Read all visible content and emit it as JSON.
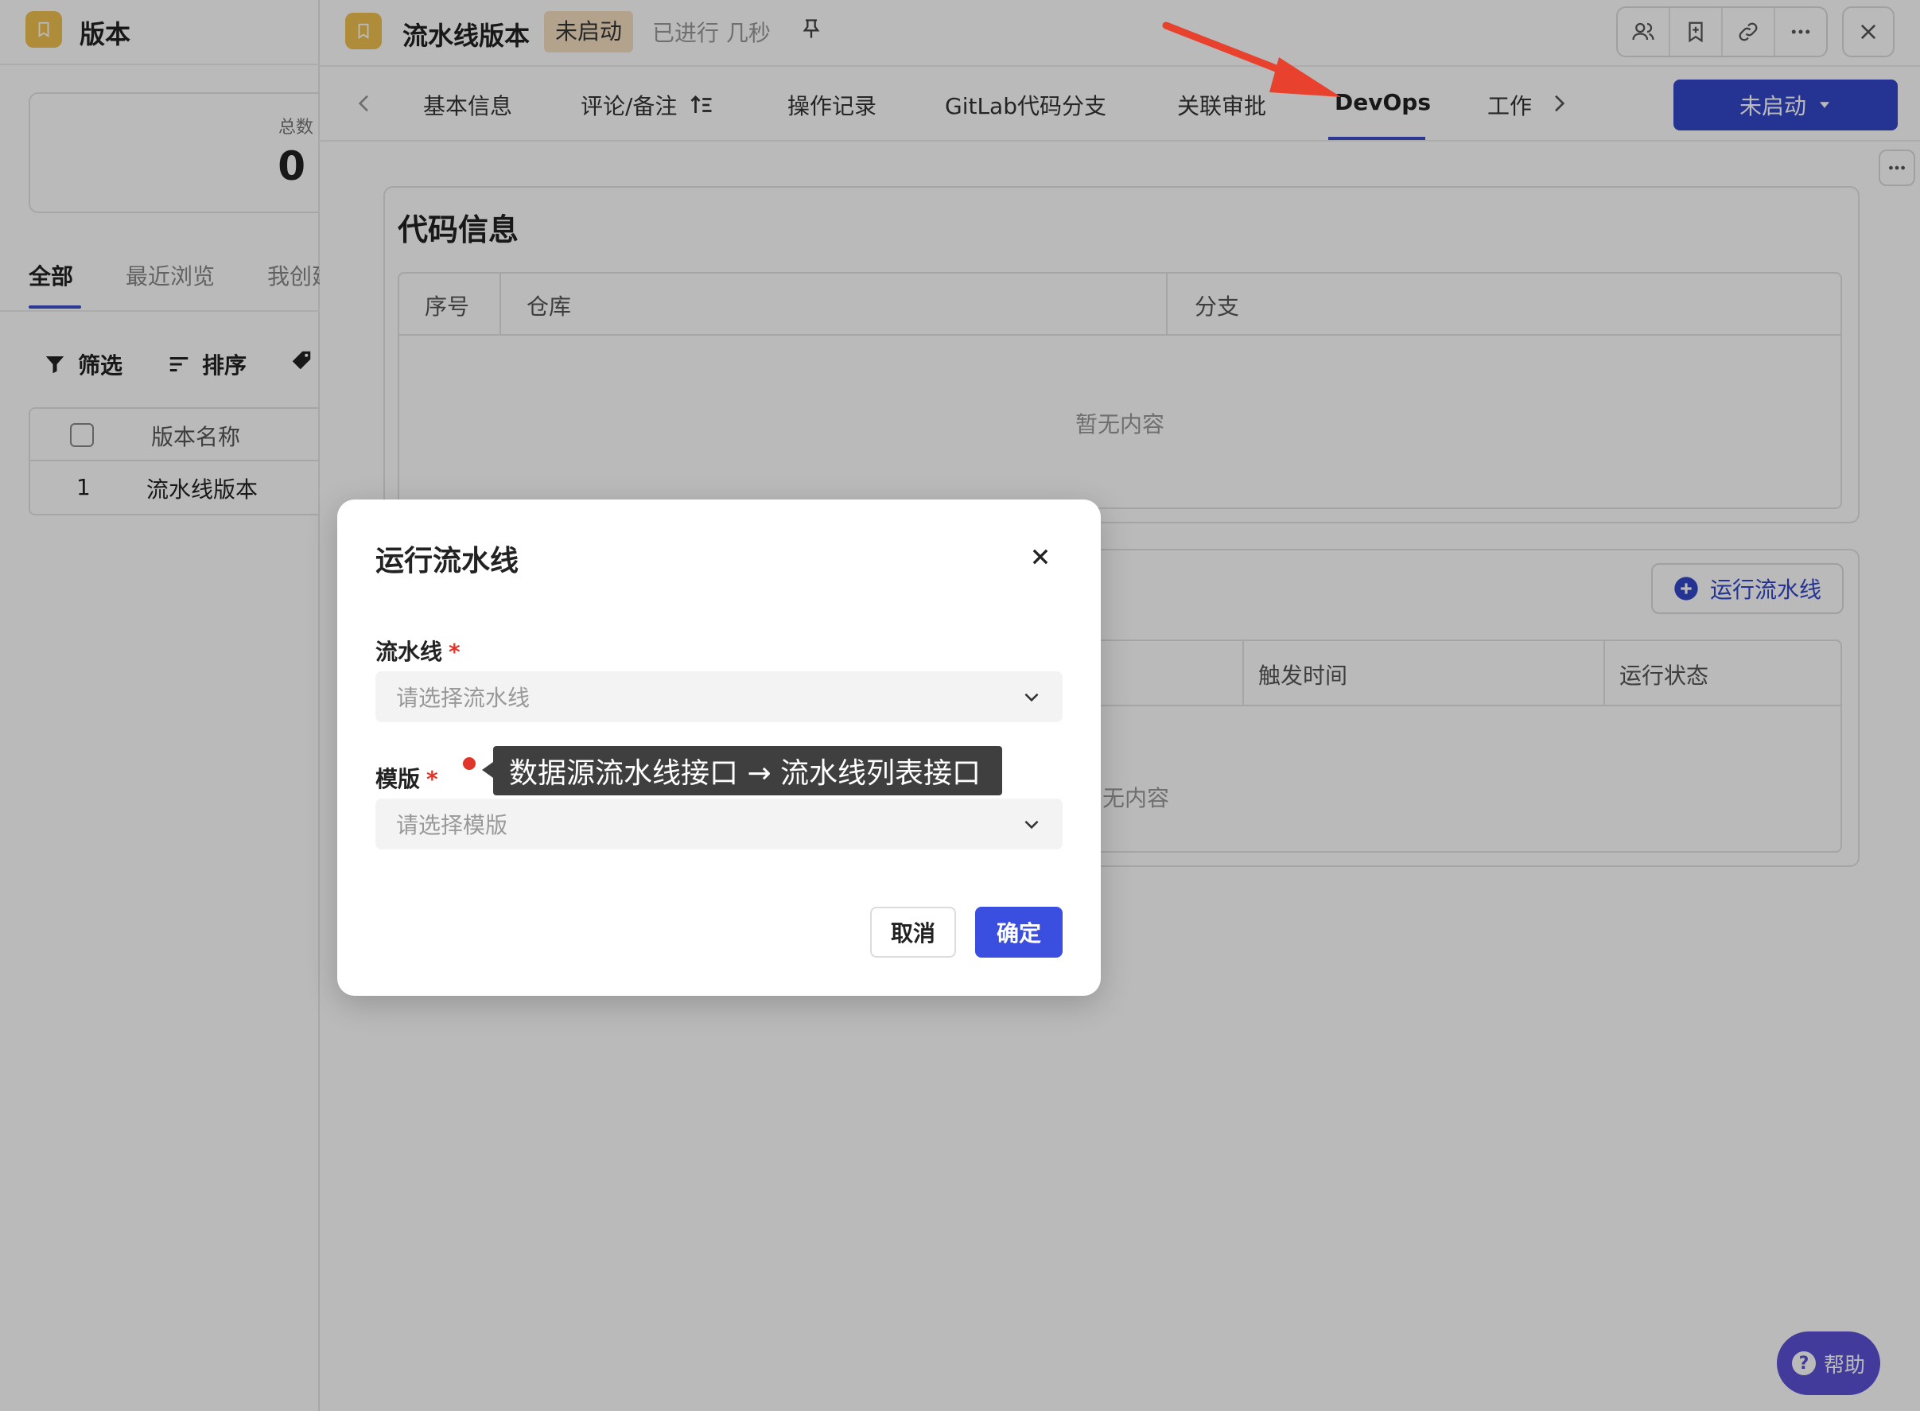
{
  "left_panel": {
    "title": "版本",
    "stat": {
      "label": "总数",
      "value": "0"
    },
    "tabs": [
      "全部",
      "最近浏览",
      "我创建"
    ],
    "tools": {
      "filter": "筛选",
      "sort": "排序"
    },
    "table": {
      "header": "版本名称",
      "rows": [
        {
          "index": "1",
          "name": "流水线版本"
        }
      ]
    }
  },
  "header": {
    "title": "流水线版本",
    "status": "未启动",
    "elapsed": "已进行 几秒",
    "pin_glyph": "ᚁ"
  },
  "tabs": [
    "基本信息",
    "评论/备注",
    "操作记录",
    "GitLab代码分支",
    "关联审批",
    "DevOps",
    "工作"
  ],
  "active_tab": "DevOps",
  "status_button": "未启动",
  "code_info": {
    "title": "代码信息",
    "columns": [
      "序号",
      "仓库",
      "分支"
    ],
    "empty": "暂无内容"
  },
  "pipeline_section": {
    "run_button": "运行流水线",
    "columns": [
      "触发时间",
      "运行状态"
    ],
    "empty": "无内容"
  },
  "dialog": {
    "title": "运行流水线",
    "pipeline_label": "流水线",
    "pipeline_placeholder": "请选择流水线",
    "template_label": "模版",
    "template_placeholder": "请选择模版",
    "required_mark": "*",
    "cancel": "取消",
    "ok": "确定"
  },
  "annotation": {
    "text": "数据源流水线接口 → 流水线列表接口"
  },
  "help": {
    "label": "帮助",
    "icon_text": "?"
  },
  "colors": {
    "accent": "#3346c9",
    "badge": "#f0c04f",
    "status_chip": "#f6e0c2",
    "required": "#e0352b"
  }
}
